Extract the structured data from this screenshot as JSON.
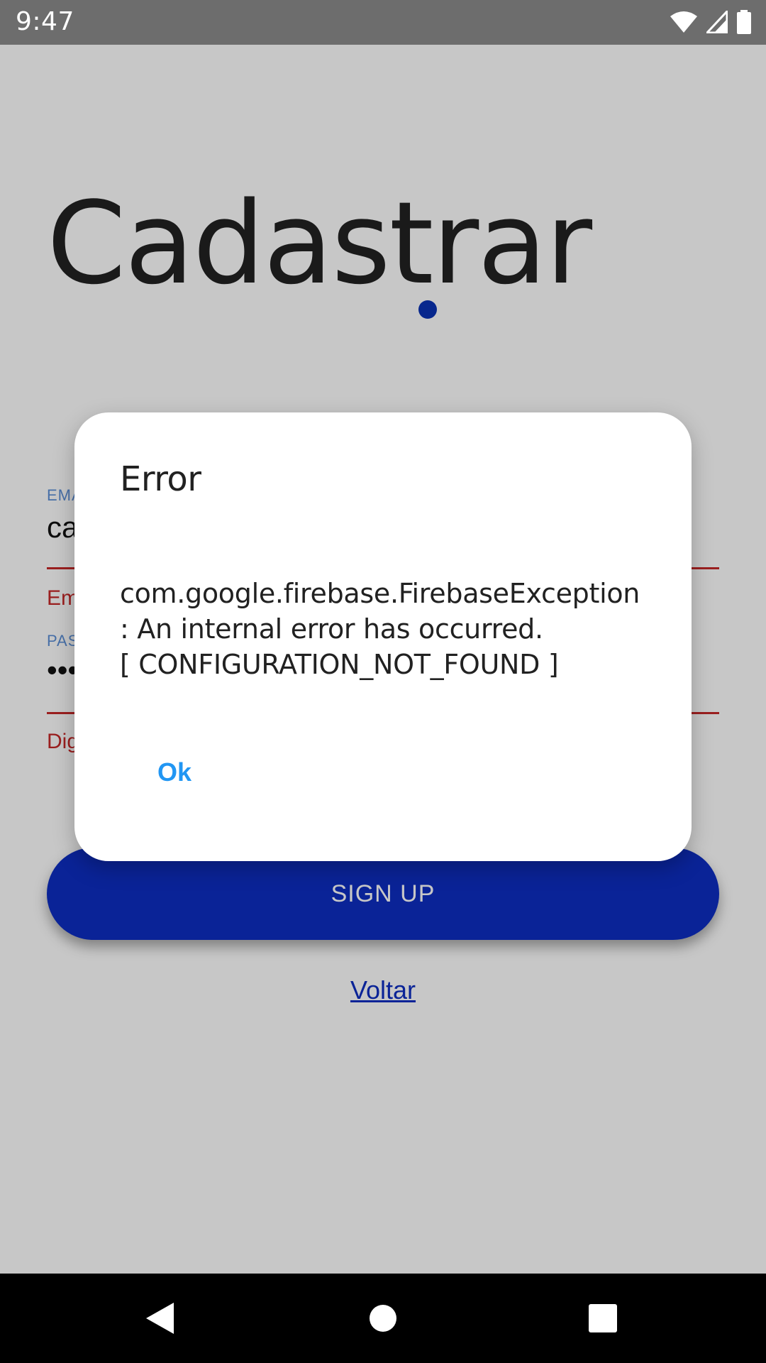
{
  "status_bar": {
    "time": "9:47",
    "icons": [
      "wifi-icon",
      "signal-icon",
      "battery-icon"
    ],
    "color": "#6d6d6d"
  },
  "page": {
    "title": "Cadastrar",
    "email": {
      "label": "EMA",
      "value": "ca",
      "error": "Em"
    },
    "password": {
      "label": "PAS",
      "value": "•••",
      "error": "Dig"
    },
    "signup_label": "SIGN UP",
    "back_label": "Voltar",
    "accent_color": "#0d2ec2",
    "error_color": "#c62828"
  },
  "dialog": {
    "title": "Error",
    "message": "com.google.firebase.FirebaseException\n: An internal error has occurred.\n[ CONFIGURATION_NOT_FOUND ]",
    "ok_label": "Ok",
    "ok_color": "#2196f3"
  },
  "nav_bar": {
    "buttons": [
      "back-icon",
      "home-icon",
      "recents-icon"
    ]
  }
}
